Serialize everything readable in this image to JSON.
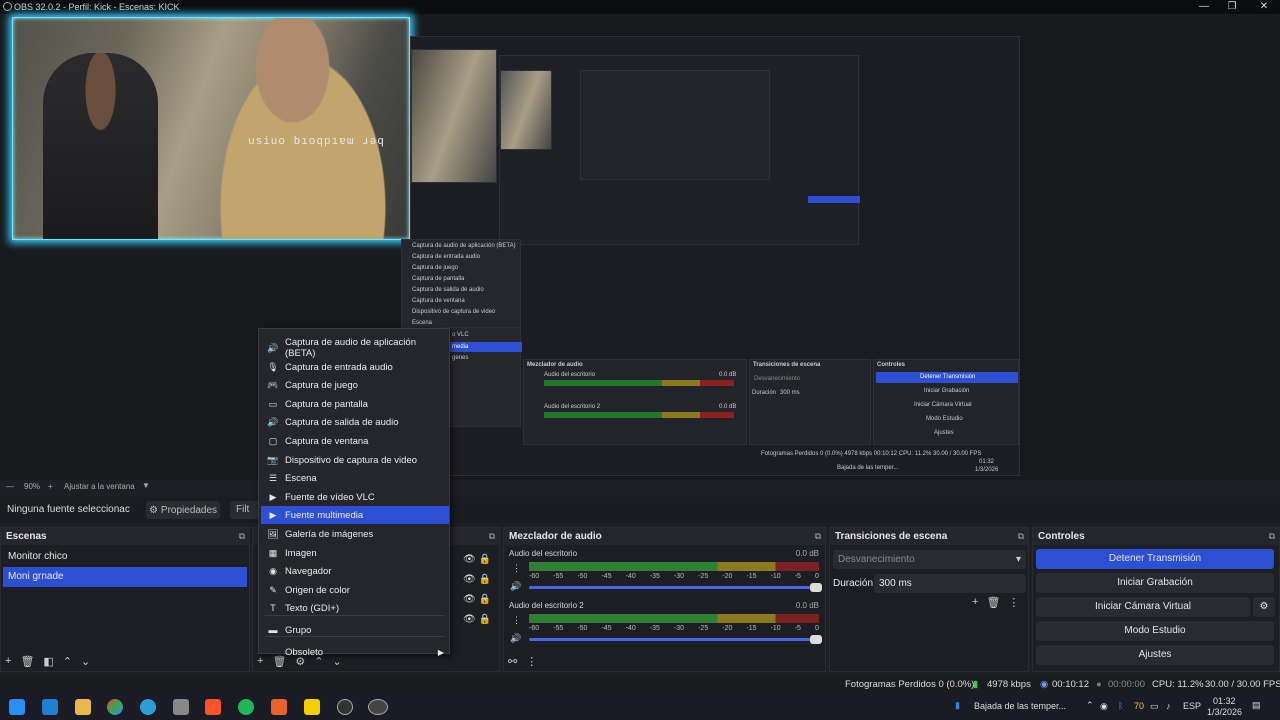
{
  "window": {
    "title": "OBS 32.0.2 - Perfil: Kick - Escenas: KICK",
    "min": "—",
    "max": "❐",
    "close": "✕"
  },
  "webcam": {
    "overlay_text": "usiuo bıoqpıɐɯ ɹǝq"
  },
  "nested": {
    "menu_items": [
      "Captura de audio de aplicación (BETA)",
      "Captura de entrada audio",
      "Captura de juego",
      "Captura de pantalla",
      "Captura de salida de audio",
      "Captura de ventana",
      "Dispositivo de captura de video",
      "Escena"
    ],
    "mixer_title": "Mezclador de audio",
    "transitions_title": "Transiciones de escena",
    "controls_title": "Controles",
    "transition_value": "Desvanecimiento",
    "duration_label": "Duración",
    "duration_value": "300 ms",
    "track1": "Audio del escritorio",
    "track2": "Audio del escritorio 2",
    "db": "0.0 dB",
    "ctl": [
      "Detener Transmisión",
      "Iniciar Grabación",
      "Iniciar Cámara Virtual",
      "Modo Estudio",
      "Ajustes"
    ],
    "status": "Fotogramas Perdidos 0 (0.0%)  4978 kbps   00:10:12   CPU: 11.2%  30.00 / 30.00 FPS",
    "tray": "Bajada de las temper...",
    "clock": "01:32",
    "date": "1/3/2026",
    "partial1": "o VLC",
    "partial2": "media",
    "partial3": "genes"
  },
  "zoom": {
    "level": "90%",
    "fit": "Ajustar a la ventana"
  },
  "context": {
    "no_source": "Ninguna fuente seleccionac",
    "properties": "Propiedades",
    "filters": "Filt"
  },
  "scenes": {
    "title": "Escenas",
    "items": [
      "Monitor chico",
      "Moni grnade"
    ],
    "selected": 1
  },
  "sources": {
    "title": "F"
  },
  "mixer": {
    "title": "Mezclador de audio",
    "tracks": [
      {
        "name": "Audio del escritorio",
        "db": "0.0 dB"
      },
      {
        "name": "Audio del escritorio 2",
        "db": "0.0 dB"
      }
    ],
    "ticks": [
      "-60",
      "-55",
      "-50",
      "-45",
      "-40",
      "-35",
      "-30",
      "-25",
      "-20",
      "-15",
      "-10",
      "-5",
      "0"
    ]
  },
  "transitions": {
    "title": "Transiciones de escena",
    "type": "Desvanecimiento",
    "duration_label": "Duración",
    "duration_value": "300 ms"
  },
  "controls": {
    "title": "Controles",
    "buttons": [
      "Detener Transmisión",
      "Iniciar Grabación",
      "Iniciar Cámara Virtual",
      "Modo Estudio",
      "Ajustes"
    ]
  },
  "menu": {
    "items": [
      {
        "label": "Captura de audio de aplicación (BETA)",
        "icon": "speaker-app-icon",
        "glyph": "🔊"
      },
      {
        "label": "Captura de entrada audio",
        "icon": "microphone-icon",
        "glyph": "🎙"
      },
      {
        "label": "Captura de juego",
        "icon": "gamepad-icon",
        "glyph": "🎮"
      },
      {
        "label": "Captura de pantalla",
        "icon": "monitor-icon",
        "glyph": "▭"
      },
      {
        "label": "Captura de salida de audio",
        "icon": "speaker-icon",
        "glyph": "🔊"
      },
      {
        "label": "Captura de ventana",
        "icon": "window-icon",
        "glyph": "▢"
      },
      {
        "label": "Dispositivo de captura de video",
        "icon": "camera-icon",
        "glyph": "📷"
      },
      {
        "label": "Escena",
        "icon": "list-icon",
        "glyph": "☰"
      },
      {
        "label": "Fuente de vídeo VLC",
        "icon": "play-icon",
        "glyph": "▶"
      },
      {
        "label": "Fuente multimedia",
        "icon": "play-icon",
        "glyph": "▶"
      },
      {
        "label": "Galería de imágenes",
        "icon": "gallery-icon",
        "glyph": "🖼"
      },
      {
        "label": "Imagen",
        "icon": "image-icon",
        "glyph": "▦"
      },
      {
        "label": "Navegador",
        "icon": "globe-icon",
        "glyph": "◉"
      },
      {
        "label": "Origen de color",
        "icon": "brush-icon",
        "glyph": "✎"
      },
      {
        "label": "Texto (GDI+)",
        "icon": "text-icon",
        "glyph": "T"
      },
      {
        "label": "Grupo",
        "icon": "folder-icon",
        "glyph": "▬"
      },
      {
        "label": "Obsoleto",
        "icon": "",
        "glyph": ""
      }
    ],
    "highlighted": 9
  },
  "status": {
    "dropped": "Fotogramas Perdidos 0 (0.0%)",
    "bitrate": "4978 kbps",
    "stream_time": "00:10:12",
    "rec_time": "00:00:00",
    "cpu": "CPU: 11.2%",
    "fps": "30.00 / 30.00 FPS"
  },
  "taskbar": {
    "weather": "Bajada de las temper...",
    "battery": "70",
    "lang": "ESP",
    "time": "01:32",
    "date": "1/3/2026"
  },
  "colors": {
    "accent": "#2d4fd4",
    "bg": "#1e1f24",
    "glow": "#38d0ff"
  }
}
